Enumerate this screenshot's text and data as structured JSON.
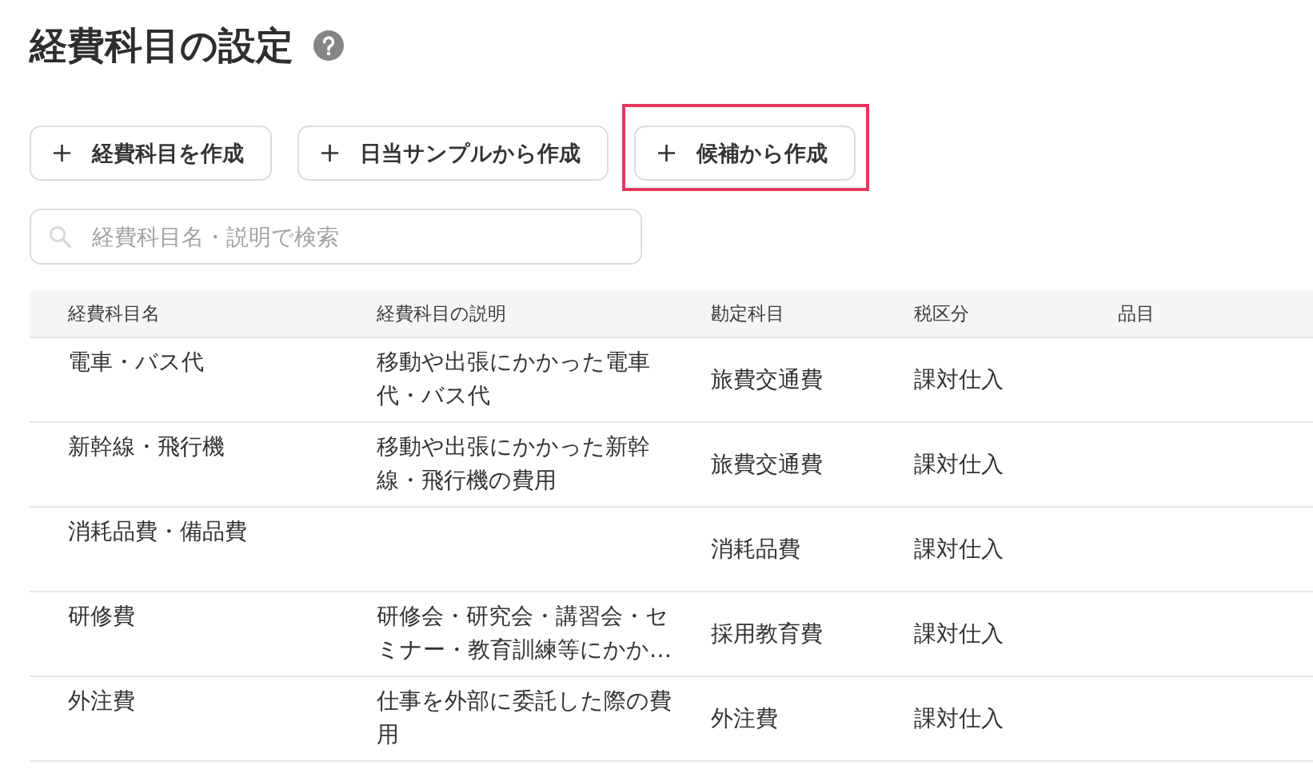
{
  "page": {
    "title": "経費科目の設定"
  },
  "actions": [
    {
      "label": "経費科目を作成",
      "highlighted": false
    },
    {
      "label": "日当サンプルから作成",
      "highlighted": false
    },
    {
      "label": "候補から作成",
      "highlighted": true
    }
  ],
  "search": {
    "placeholder": "経費科目名・説明で検索"
  },
  "table": {
    "columns": [
      "経費科目名",
      "経費科目の説明",
      "勘定科目",
      "税区分",
      "品目"
    ],
    "rows": [
      {
        "name": "電車・バス代",
        "description": "移動や出張にかかった電車代・バス代",
        "account": "旅費交通費",
        "tax_category": "課対仕入"
      },
      {
        "name": "新幹線・飛行機",
        "description": "移動や出張にかかった新幹線・飛行機の費用",
        "account": "旅費交通費",
        "tax_category": "課対仕入"
      },
      {
        "name": "消耗品費・備品費",
        "account": "消耗品費",
        "tax_category": "課対仕入"
      },
      {
        "name": "研修費",
        "description": "研修会・研究会・講習会・セミナー・教育訓練等にかか…",
        "account": "採用教育費",
        "tax_category": "課対仕入"
      },
      {
        "name": "外注費",
        "description": "仕事を外部に委託した際の費用",
        "account": "外注費",
        "tax_category": "課対仕入"
      }
    ]
  }
}
